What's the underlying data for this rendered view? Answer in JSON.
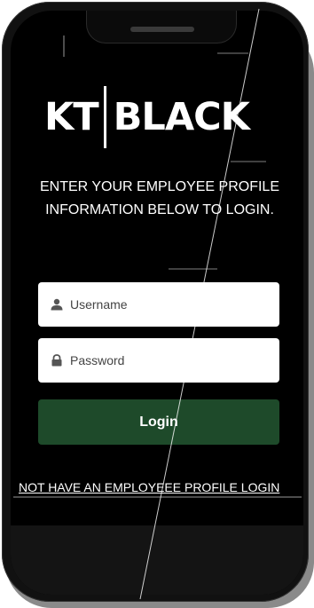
{
  "logo": {
    "left": "KT",
    "right": "BLACK"
  },
  "instructions": "ENTER YOUR EMPLOYEE PROFILE INFORMATION BELOW TO LOGIN.",
  "username": {
    "placeholder": "Username",
    "value": "",
    "icon": "user-icon"
  },
  "password": {
    "placeholder": "Password",
    "value": "",
    "icon": "lock-icon"
  },
  "login_button": "Login",
  "signup_link": "NOT HAVE AN EMPLOYEEE PROFILE LOGIN",
  "colors": {
    "background": "#000000",
    "button": "#1e4a2a",
    "text": "#ffffff",
    "field": "#ffffff"
  }
}
